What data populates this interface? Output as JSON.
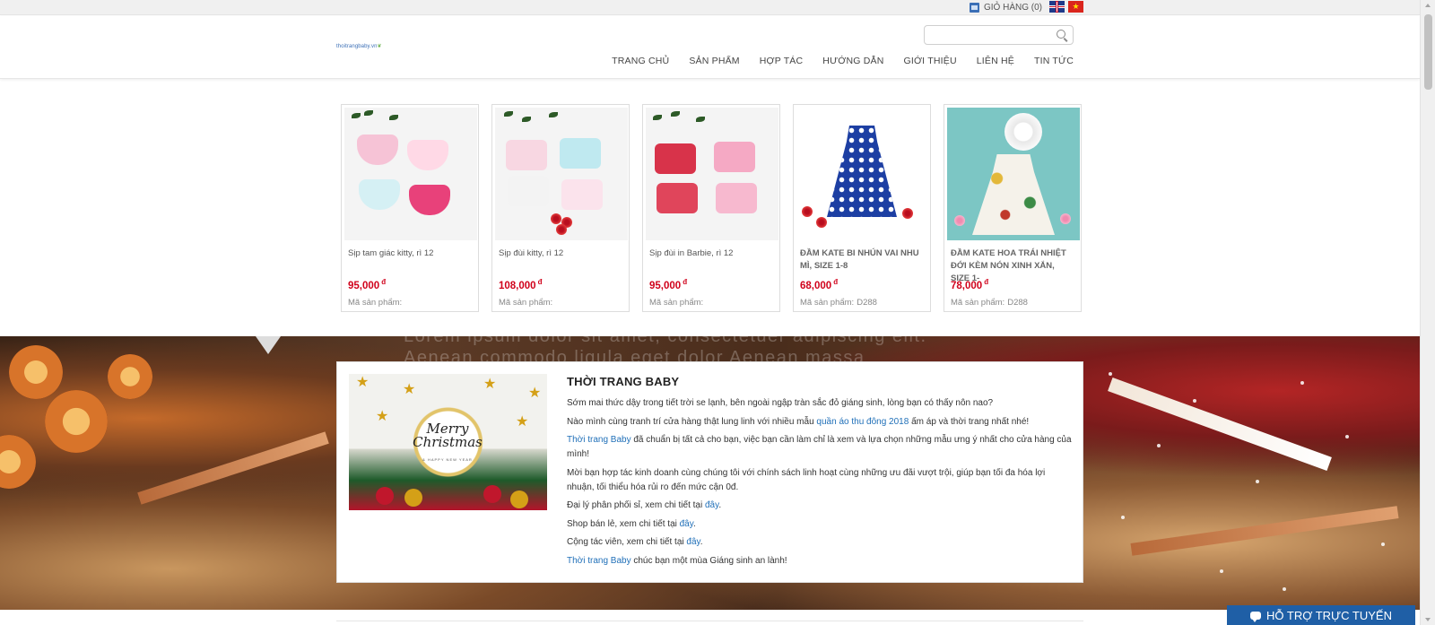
{
  "topbar": {
    "cart_label": "GIỎ HÀNG (0)",
    "flag_vn_label": "★"
  },
  "header": {
    "logo_text": "thoitrangbaby.vn",
    "search_placeholder": "",
    "nav": [
      "TRANG CHỦ",
      "SẢN PHẨM",
      "HỢP TÁC",
      "HƯỚNG DẪN",
      "GIỚI THIỆU",
      "LIÊN HỆ",
      "TIN TỨC"
    ]
  },
  "products": [
    {
      "name": "Sịp tam giác kitty, rì 12",
      "price": "95,000",
      "currency": "đ",
      "code_label": "Mã sản phẩm:",
      "code": ""
    },
    {
      "name": "Sịp đùi kitty, rì 12",
      "price": "108,000",
      "currency": "đ",
      "code_label": "Mã sản phẩm:",
      "code": ""
    },
    {
      "name": "Sịp đùi in Barbie, rì 12",
      "price": "95,000",
      "currency": "đ",
      "code_label": "Mã sản phẩm:",
      "code": ""
    },
    {
      "name": "ĐẦM KATE BI NHÚN VAI NHU MÌ, SIZE 1-8",
      "price": "68,000",
      "currency": "đ",
      "code_label": "Mã sản phẩm:",
      "code": "D288"
    },
    {
      "name": "ĐẦM KATE HOA TRÁI NHIỆT ĐỚI KÈM NÓN XINH XẮN, SIZE 1-",
      "price": "78,000",
      "currency": "đ",
      "code_label": "Mã sản phẩm:",
      "code": "D288"
    }
  ],
  "banner": {
    "ghost_line1": "Lorem ipsum dolor sit amet, consectetuer adipiscing elit.",
    "ghost_line2": "Aenean commodo ligula eget dolor Aenean massa",
    "card_image": {
      "merry": "Merry",
      "christmas": "Christmas",
      "amp": "&",
      "happy_new_year": "HAPPY NEW YEAR"
    },
    "title": "THỜI TRANG BABY",
    "p1": "Sớm mai thức dậy trong tiết trời se lạnh, bên ngoài ngập tràn sắc đỏ giáng sinh, lòng bạn có thấy nôn nao?",
    "p2_pre": "Nào mình cùng tranh trí cửa hàng thật lung linh với nhiều mẫu ",
    "p2_link": "quần áo thu đông 2018",
    "p2_post": " ấm áp và thời trang nhất nhé!",
    "p3_link": "Thời trang Baby",
    "p3_post": " đã chuẩn bị tất cả cho bạn, việc bạn cần làm chỉ là xem và lựa chọn những mẫu ưng ý nhất cho cửa hàng của mình!",
    "p4": "Mời bạn hợp tác kinh doanh cùng chúng tôi với chính sách linh hoạt cùng những ưu đãi vượt trội, giúp bạn tối đa hóa lợi nhuận, tối thiểu hóa rủi ro đến mức cận 0đ.",
    "p5_pre": "Đại lý phân phối sỉ, xem chi tiết tại ",
    "p5_link": "đây",
    "p6_pre": "Shop bán lẻ, xem chi tiết tại ",
    "p6_link": "đây",
    "p7_pre": "Cộng tác viên, xem chi tiết tại ",
    "p7_link": "đây",
    "p8_link": "Thời trang Baby",
    "p8_post": " chúc bạn một mùa Giáng sinh an lành!",
    "period": "."
  },
  "support": {
    "label": "HỖ TRỢ TRỰC TUYẾN"
  },
  "colors": {
    "price_red": "#d0021b",
    "link_blue": "#1f6fb8",
    "support_blue": "#1f5fa6"
  }
}
